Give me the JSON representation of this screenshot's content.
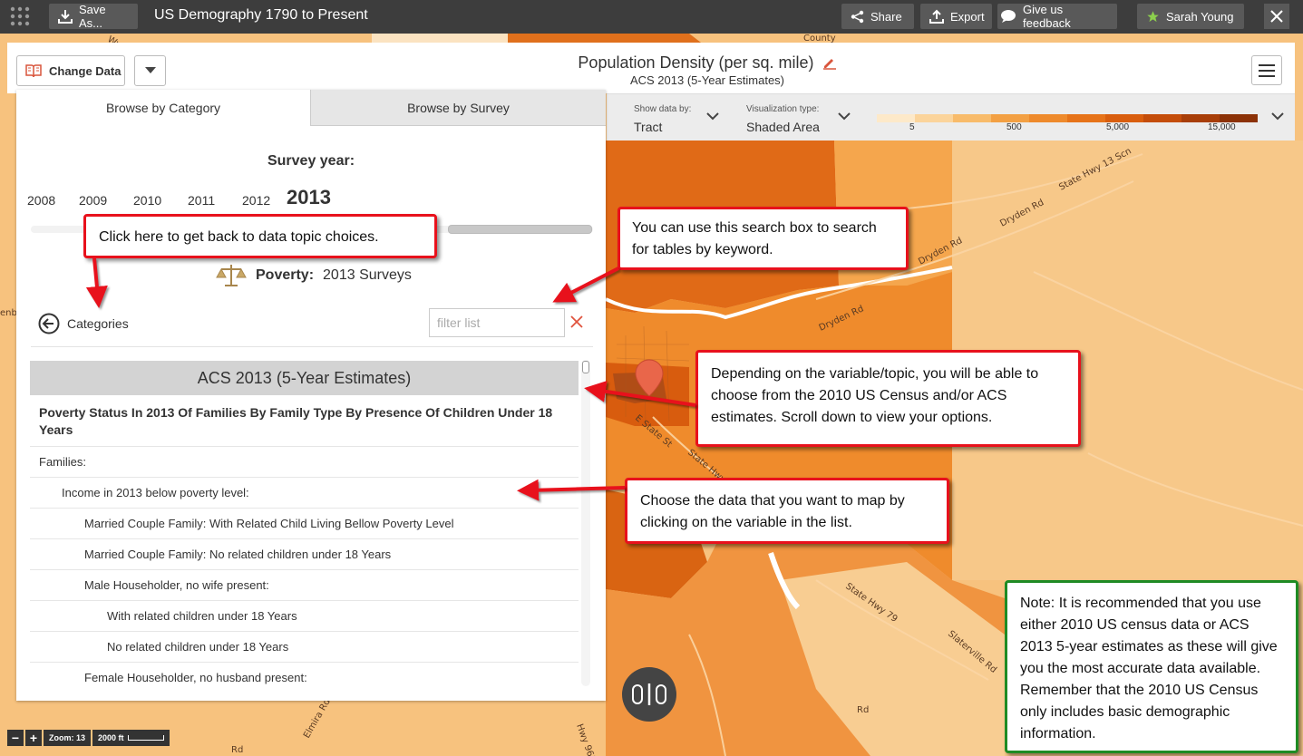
{
  "topbar": {
    "save_label": "Save As...",
    "title": "US Demography 1790 to Present",
    "share_label": "Share",
    "export_label": "Export",
    "feedback_label": "Give us feedback",
    "user_name": "Sarah  Young"
  },
  "header": {
    "change_data_label": "Change Data",
    "map_title": "Population Density (per sq. mile)",
    "map_subtitle": "ACS 2013 (5-Year Estimates)"
  },
  "legend": {
    "show_data_label": "Show data by:",
    "show_data_value": "Tract",
    "viz_label": "Visualization type:",
    "viz_value": "Shaded Area",
    "ticks": [
      "5",
      "500",
      "5,000",
      "15,000"
    ],
    "colors": [
      "#fde9c9",
      "#fbd49b",
      "#f8bb6a",
      "#f3a043",
      "#ee8a2c",
      "#e67319",
      "#d95e0e",
      "#c44d0a",
      "#a83e08",
      "#8c3207"
    ]
  },
  "panel": {
    "tabs": [
      "Browse by Category",
      "Browse by Survey"
    ],
    "survey_year_label": "Survey year:",
    "years": [
      "2008",
      "2009",
      "2010",
      "2011",
      "2012",
      "2013"
    ],
    "selected_year": "2013",
    "topic_name": "Poverty:",
    "topic_surveys": "2013 Surveys",
    "back_label": "Categories",
    "filter_placeholder": "filter list",
    "survey_header": "ACS 2013 (5-Year Estimates)",
    "table_title": "Poverty Status In 2013 Of Families By Family Type By Presence Of Children Under 18 Years",
    "rows": [
      "Families:",
      "Income in 2013 below poverty level:",
      "Married Couple Family: With Related Child Living  Bellow Poverty Level",
      "Married Couple Family: No related children under 18 Years",
      "Male Householder, no wife present:",
      "With related children under 18 Years",
      "No related children under 18 Years",
      "Female Householder, no husband present:"
    ]
  },
  "map": {
    "roads": [
      "Dryden Rd",
      "Dryden Rd",
      "Dryden Rd",
      "State Hwy 13 Scn",
      "E State St",
      "State Hwy",
      "State Hwy 79",
      "Slaterville Rd",
      "Elmira Rd",
      "Rd",
      "Rd",
      "County",
      "Wy",
      "enbu",
      "Hwy 96B"
    ],
    "zoom_label": "Zoom: 13",
    "scale_label": "2000 ft"
  },
  "callouts": {
    "back": "Click here to get back to data topic choices.",
    "search": "You can use this search box to search for tables by keyword.",
    "survey": "Depending on the variable/topic, you will be able to choose from the 2010 US Census and/or ACS estimates.  Scroll down to view your options.",
    "choose": "Choose the data that you want to map by clicking on the variable in the list.",
    "note": "Note: It is recommended that you use either 2010 US census data or ACS 2013 5-year estimates as these will give you the most accurate data available.  Remember that the 2010 US Census only includes basic demographic information."
  }
}
